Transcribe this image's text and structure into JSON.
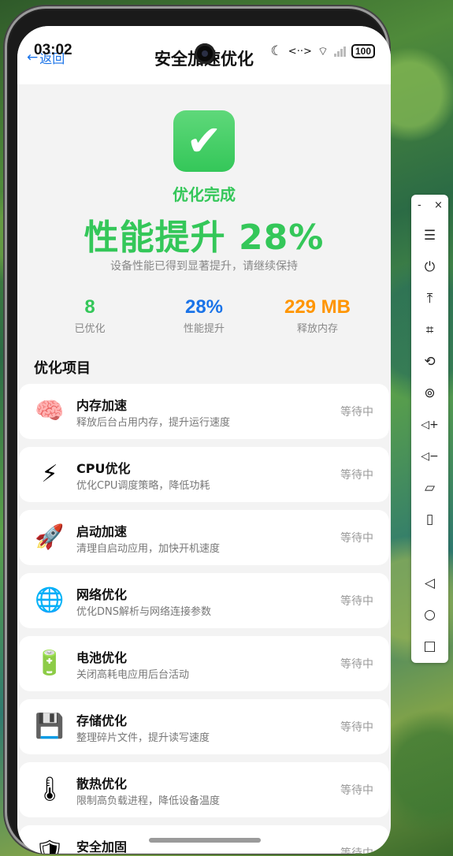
{
  "status_bar": {
    "time": "03:02",
    "battery": "100",
    "icons": [
      "moon-icon",
      "data-transfer-icon",
      "wifi-icon",
      "signal-icon",
      "battery-icon"
    ]
  },
  "header": {
    "back_label": "返回",
    "title": "安全加速优化"
  },
  "result": {
    "status": "优化完成",
    "headline": "性能提升 28%",
    "subtitle": "设备性能已得到显著提升，请继续保持",
    "stats": [
      {
        "value": "8",
        "label": "已优化",
        "color": "#34c759"
      },
      {
        "value": "28%",
        "label": "性能提升",
        "color": "#1a73e8"
      },
      {
        "value": "229 MB",
        "label": "释放内存",
        "color": "#ff9500"
      }
    ]
  },
  "section_title": "优化项目",
  "items": [
    {
      "icon": "🧠",
      "name": "内存加速",
      "desc": "释放后台占用内存，提升运行速度",
      "status": "等待中"
    },
    {
      "icon": "⚡",
      "name": "CPU优化",
      "desc": "优化CPU调度策略，降低功耗",
      "status": "等待中"
    },
    {
      "icon": "🚀",
      "name": "启动加速",
      "desc": "清理自启动应用，加快开机速度",
      "status": "等待中"
    },
    {
      "icon": "🌐",
      "name": "网络优化",
      "desc": "优化DNS解析与网络连接参数",
      "status": "等待中"
    },
    {
      "icon": "🔋",
      "name": "电池优化",
      "desc": "关闭高耗电应用后台活动",
      "status": "等待中"
    },
    {
      "icon": "💾",
      "name": "存储优化",
      "desc": "整理碎片文件，提升读写速度",
      "status": "等待中"
    },
    {
      "icon": "🌡",
      "name": "散热优化",
      "desc": "限制高负载进程，降低设备温度",
      "status": "等待中"
    },
    {
      "icon": "🛡",
      "name": "安全加固",
      "desc": "",
      "status": "等待中"
    }
  ],
  "toolbar": {
    "minimize": "-",
    "close": "×",
    "buttons": [
      {
        "name": "menu-icon",
        "glyph": "☰"
      },
      {
        "name": "power-icon",
        "glyph": "⏻"
      },
      {
        "name": "upload-icon",
        "glyph": "⤒"
      },
      {
        "name": "crop-icon",
        "glyph": "⌗"
      },
      {
        "name": "rotate-icon",
        "glyph": "⟲"
      },
      {
        "name": "screen-record-icon",
        "glyph": "⊚"
      },
      {
        "name": "volume-up-icon",
        "glyph": "◁+"
      },
      {
        "name": "volume-down-icon",
        "glyph": "◁−"
      },
      {
        "name": "shake-icon",
        "glyph": "▱"
      },
      {
        "name": "device-icon",
        "glyph": "▯"
      },
      {
        "name": "back-icon",
        "glyph": "◁"
      },
      {
        "name": "home-icon",
        "glyph": "○"
      },
      {
        "name": "recents-icon",
        "glyph": "□"
      }
    ]
  }
}
